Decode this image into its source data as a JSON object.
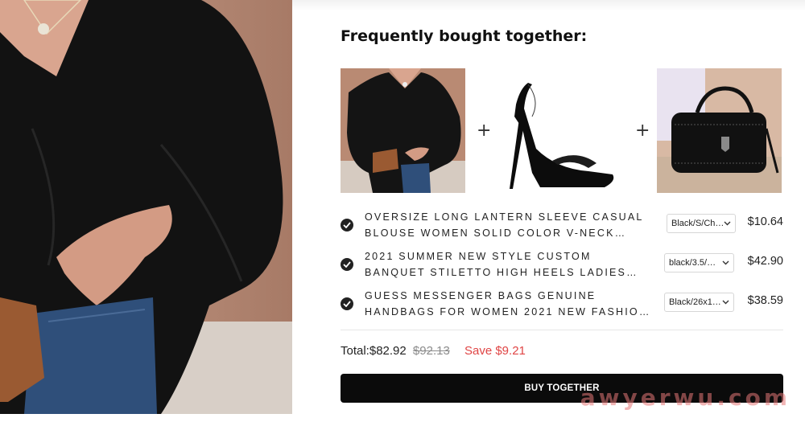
{
  "title": "Frequently bought together:",
  "plus_sign": "+",
  "products": [
    {
      "name_line1": "OVERSIZE LONG LANTERN SLEEVE CASUAL",
      "name_line2": "BLOUSE WOMEN SOLID COLOR V-NECK…",
      "variant": "Black/S/Ch…",
      "price": "$10.64",
      "selected": true,
      "image": "black-blouse-photo"
    },
    {
      "name_line1": "2021 SUMMER NEW STYLE CUSTOM",
      "name_line2": "BANQUET STILETTO HIGH HEELS LADIES…",
      "variant": "black/3.5/…",
      "price": "$42.90",
      "selected": true,
      "image": "black-stiletto-sandal-photo"
    },
    {
      "name_line1": "GUESS MESSENGER BAGS GENUINE",
      "name_line2": "HANDBAGS FOR WOMEN 2021 NEW FASHIO…",
      "variant": "Black/26x1…",
      "price": "$38.59",
      "selected": true,
      "image": "black-leather-handbag-photo"
    }
  ],
  "summary": {
    "total_label": "Total:",
    "total_price": "$82.92",
    "original_price": "$92.13",
    "save_text": "Save $9.21"
  },
  "buy_button_label": "BUY TOGETHER",
  "watermark": "awyerwu.com",
  "icons": {
    "check": "check-icon",
    "chevron": "chevron-down-icon"
  },
  "colors": {
    "save_red": "#e04545",
    "button_bg": "#0b0b0b"
  }
}
